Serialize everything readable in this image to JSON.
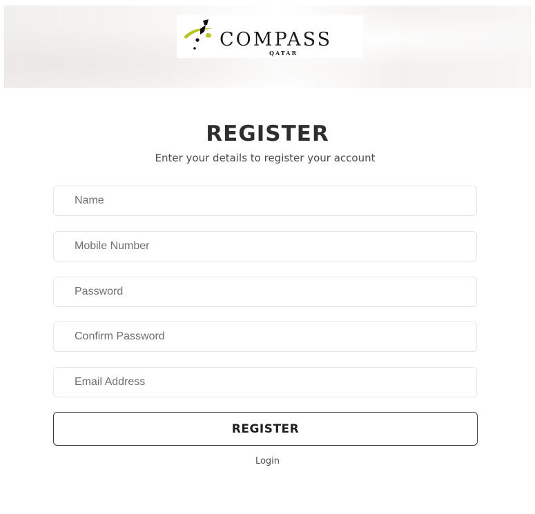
{
  "header": {
    "logo": {
      "wordmark": "COMPASS",
      "subtext": "QATAR"
    }
  },
  "form": {
    "title": "REGISTER",
    "subtitle": "Enter your details to register your account",
    "fields": {
      "name": {
        "value": "",
        "placeholder": "Name"
      },
      "mobile": {
        "value": "",
        "placeholder": "Mobile Number"
      },
      "password": {
        "value": "",
        "placeholder": "Password"
      },
      "confirm_password": {
        "value": "",
        "placeholder": "Confirm Password"
      },
      "email": {
        "value": "",
        "placeholder": "Email Address"
      }
    },
    "submit_label": "REGISTER",
    "login_link": "Login"
  },
  "colors": {
    "logo_accent": "#b8c424",
    "text_dark": "#2e2e2e",
    "field_border": "#e6e6e6",
    "button_border": "#3a3a3a"
  }
}
